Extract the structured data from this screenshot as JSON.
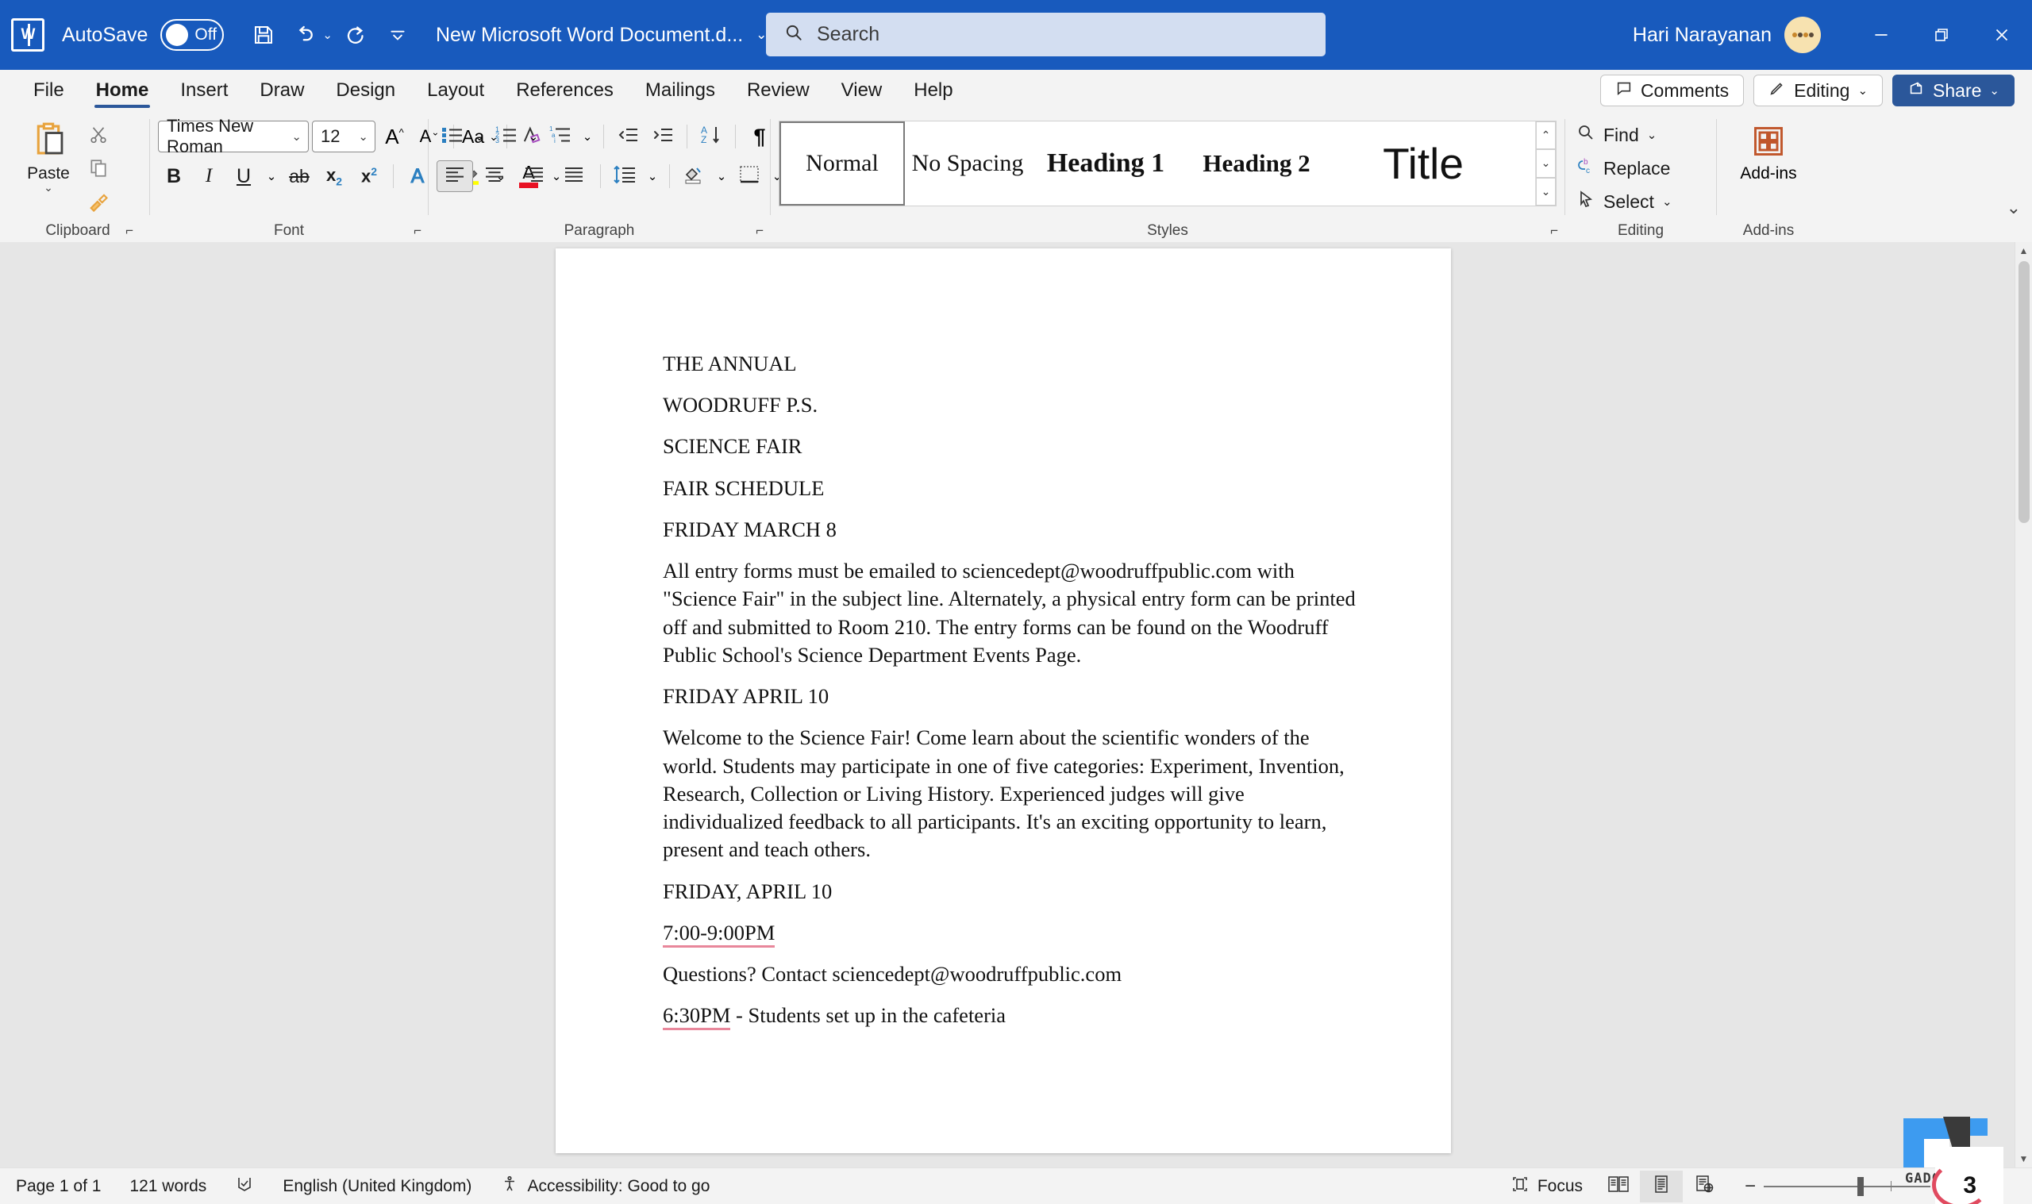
{
  "titlebar": {
    "app_icon": "word-logo",
    "autosave_label": "AutoSave",
    "autosave_state": "Off",
    "save_icon": "save-icon",
    "undo_icon": "undo-icon",
    "redo_icon": "redo-icon",
    "qat_more_icon": "qat-overflow-icon",
    "document_title": "New Microsoft Word Document.d...",
    "title_chevron": "chevron-down-icon",
    "search_placeholder": "Search",
    "search_value": "",
    "search_icon": "search-icon",
    "user_name": "Hari Narayanan",
    "avatar_initials": "",
    "minimize": "minimize-icon",
    "restore": "restore-icon",
    "close": "close-icon",
    "accent_color": "#185ABD"
  },
  "tabs": [
    {
      "label": "File",
      "active": false
    },
    {
      "label": "Home",
      "active": true
    },
    {
      "label": "Insert",
      "active": false
    },
    {
      "label": "Draw",
      "active": false
    },
    {
      "label": "Design",
      "active": false
    },
    {
      "label": "Layout",
      "active": false
    },
    {
      "label": "References",
      "active": false
    },
    {
      "label": "Mailings",
      "active": false
    },
    {
      "label": "Review",
      "active": false
    },
    {
      "label": "View",
      "active": false
    },
    {
      "label": "Help",
      "active": false
    }
  ],
  "tab_actions": {
    "comments_label": "Comments",
    "comments_icon": "comment-icon",
    "editing_label": "Editing",
    "editing_icon": "pencil-icon",
    "editing_chevron": "chevron-down-icon",
    "share_label": "Share",
    "share_icon": "share-icon",
    "share_chevron": "chevron-down-icon",
    "share_color": "#2b579a"
  },
  "ribbon": {
    "clipboard": {
      "group_label": "Clipboard",
      "paste_label": "Paste",
      "paste_icon": "paste-icon",
      "cut_icon": "scissors-icon",
      "copy_icon": "copy-icon",
      "format_painter_icon": "format-painter-icon",
      "launcher_icon": "dialog-launcher-icon"
    },
    "font": {
      "group_label": "Font",
      "font_name": "Times New Roman",
      "font_size": "12",
      "grow_font_icon": "grow-font-icon",
      "shrink_font_icon": "shrink-font-icon",
      "change_case_label": "Aa",
      "clear_formatting_icon": "clear-formatting-icon",
      "bold_label": "B",
      "italic_label": "I",
      "underline_label": "U",
      "strikethrough_label": "ab",
      "subscript_label": "x",
      "superscript_label": "x",
      "text_effects_icon": "text-effects-icon",
      "highlight_icon": "highlight-icon",
      "font_color_icon": "font-color-icon",
      "highlight_color": "#ffff00",
      "font_color": "#e81123",
      "launcher_icon": "dialog-launcher-icon"
    },
    "paragraph": {
      "group_label": "Paragraph",
      "bullets_icon": "bullets-icon",
      "numbering_icon": "numbering-icon",
      "multilevel_icon": "multilevel-list-icon",
      "decrease_indent_icon": "decrease-indent-icon",
      "increase_indent_icon": "increase-indent-icon",
      "sort_icon": "sort-icon",
      "show_marks_icon": "paragraph-marks-icon",
      "align_left_icon": "align-left-icon",
      "align_center_icon": "align-center-icon",
      "align_right_icon": "align-right-icon",
      "justify_icon": "justify-icon",
      "line_spacing_icon": "line-spacing-icon",
      "shading_icon": "shading-icon",
      "borders_icon": "borders-icon",
      "launcher_icon": "dialog-launcher-icon"
    },
    "styles": {
      "group_label": "Styles",
      "items": [
        {
          "label": "Normal",
          "selected": true
        },
        {
          "label": "No Spacing",
          "selected": false
        },
        {
          "label": "Heading 1",
          "selected": false
        },
        {
          "label": "Heading 2",
          "selected": false
        },
        {
          "label": "Title",
          "selected": false
        }
      ],
      "scroll_up_icon": "chevron-up-icon",
      "scroll_down_icon": "chevron-down-icon",
      "more_icon": "styles-more-icon",
      "launcher_icon": "dialog-launcher-icon"
    },
    "editing": {
      "group_label": "Editing",
      "find_label": "Find",
      "find_icon": "search-icon",
      "find_chevron": "chevron-down-icon",
      "replace_label": "Replace",
      "replace_icon": "replace-icon",
      "select_label": "Select",
      "select_icon": "cursor-arrow-icon",
      "select_chevron": "chevron-down-icon"
    },
    "addins": {
      "group_label": "Add-ins",
      "button_label": "Add-ins",
      "icon": "addins-grid-icon"
    },
    "collapse_icon": "chevron-up-icon"
  },
  "document": {
    "paragraphs": [
      {
        "text": "THE ANNUAL",
        "type": "heading"
      },
      {
        "text": "WOODRUFF P.S.",
        "type": "heading"
      },
      {
        "text": "SCIENCE FAIR",
        "type": "heading"
      },
      {
        "text": "FAIR SCHEDULE",
        "type": "heading"
      },
      {
        "text": "FRIDAY MARCH 8",
        "type": "heading"
      },
      {
        "text": "All entry forms must be emailed to sciencedept@woodruffpublic.com with \"Science Fair\" in the subject line. Alternately, a physical entry form can be printed off and submitted to Room 210. The entry forms can be found on the Woodruff Public School's Science Department Events Page.",
        "type": "body"
      },
      {
        "text": "FRIDAY APRIL 10",
        "type": "heading"
      },
      {
        "text": "Welcome to the Science Fair! Come learn about the scientific wonders of the world. Students may participate in one of five categories: Experiment, Invention, Research, Collection or Living History. Experienced judges will give individualized feedback to all participants. It's an exciting opportunity to learn, present and teach others.",
        "type": "body"
      },
      {
        "text": "FRIDAY, APRIL 10",
        "type": "heading"
      },
      {
        "text": "7:00-9:00PM",
        "type": "body-spell"
      },
      {
        "text": "Questions? Contact sciencedept@woodruffpublic.com",
        "type": "body"
      },
      {
        "text": "6:30PM - Students set up in the cafeteria",
        "type": "body-spell2"
      }
    ],
    "spell_marks": {
      "line_7_00": "7:00-9:00PM",
      "line_6_30": "6:30PM"
    }
  },
  "statusbar": {
    "page_info": "Page 1 of 1",
    "word_count": "121 words",
    "proofing_icon": "proofing-icon",
    "language": "English (United Kingdom)",
    "accessibility_icon": "accessibility-icon",
    "accessibility": "Accessibility: Good to go",
    "focus_label": "Focus",
    "focus_icon": "focus-icon",
    "read_mode_icon": "read-mode-icon",
    "print_layout_icon": "print-layout-icon",
    "web_layout_icon": "web-layout-icon",
    "zoom_out_icon": "zoom-out-icon",
    "zoom_in_icon": "zoom-in-icon",
    "zoom_level": ""
  },
  "watermark": {
    "text": "GADGETS",
    "number": "3",
    "color": "#3d9bf0"
  }
}
